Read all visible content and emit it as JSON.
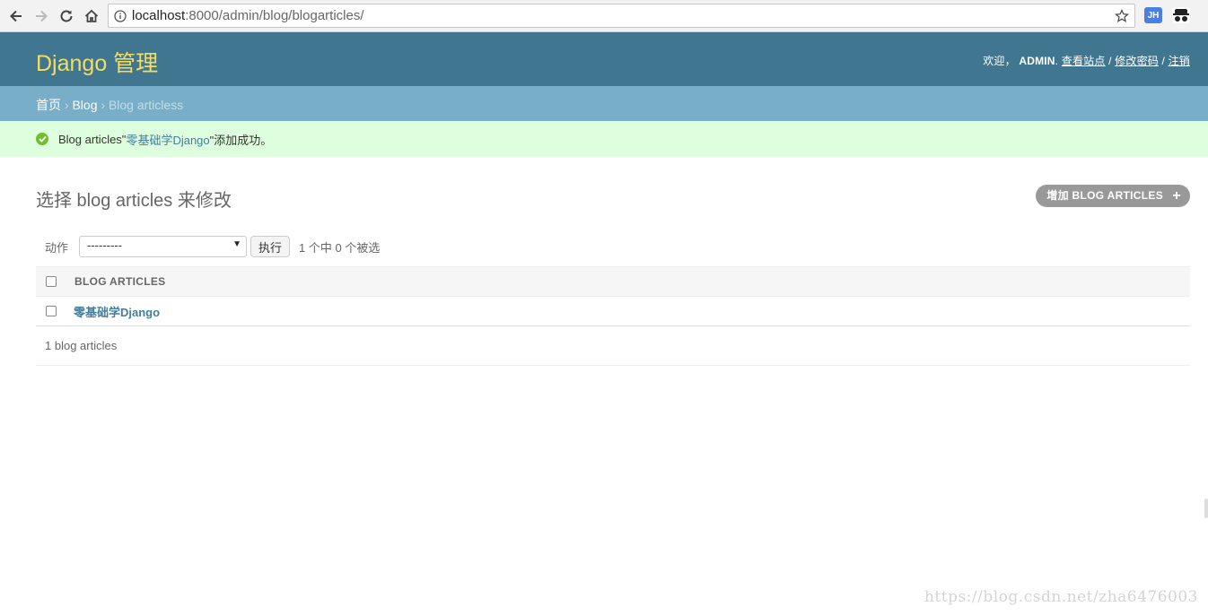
{
  "browser": {
    "url_host": "localhost",
    "url_rest": ":8000/admin/blog/blogarticles/",
    "ext1": "JH"
  },
  "header": {
    "branding": "Django 管理",
    "welcome": "欢迎，",
    "username": "ADMIN",
    "view_site": "查看站点",
    "change_password": "修改密码",
    "logout": "注销",
    "sep": " / "
  },
  "breadcrumbs": {
    "home": "首页",
    "app": "Blog",
    "current": "Blog articless",
    "sep": " › "
  },
  "message": {
    "prefix": "Blog articles\"",
    "link": "零基础学Django",
    "suffix": "\"添加成功。"
  },
  "content": {
    "title": "选择 blog articles 来修改",
    "add_button": "增加 BLOG ARTICLES",
    "actions_label": "动作",
    "action_selected": "---------",
    "go_button": "执行",
    "selection_counter": "1 个中 0 个被选",
    "column_header": "BLOG ARTICLES",
    "rows": [
      "零基础学Django"
    ],
    "paginator": "1 blog articles"
  },
  "watermark": "https://blog.csdn.net/zha6476003",
  "colors": {
    "header_bg": "#417690",
    "branding": "#f5dd5d",
    "breadcrumbs_bg": "#79aec8",
    "message_bg": "#ddffdd",
    "success_icon": "#70bf2b",
    "link": "#447e9b"
  }
}
